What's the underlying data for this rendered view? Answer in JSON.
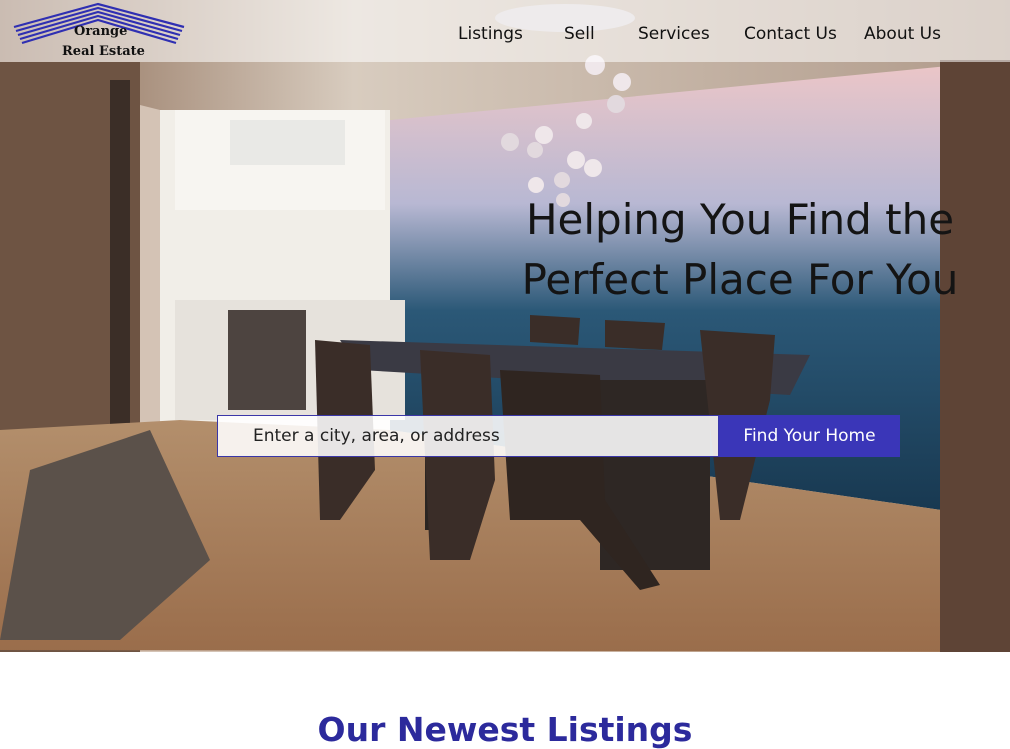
{
  "brand": {
    "line1": "Orange",
    "line2": "Real Estate",
    "color": "#2f2fb2"
  },
  "nav": {
    "listings": "Listings",
    "sell": "Sell",
    "services": "Services",
    "contact": "Contact Us",
    "about": "About Us"
  },
  "hero": {
    "headline_line1": "Helping You Find the",
    "headline_line2": "Perfect Place For You",
    "search_placeholder": "Enter a city, area, or address",
    "search_button": "Find Your Home",
    "accent": "#3a36b8"
  },
  "listings_section": {
    "title": "Our Newest Listings",
    "title_color": "#2c2a9c"
  }
}
